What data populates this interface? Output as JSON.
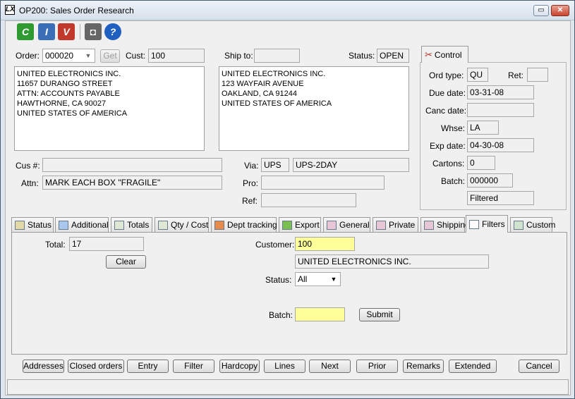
{
  "window": {
    "title": "OP200: Sales Order Research",
    "app_icon": "LX"
  },
  "toolbar": [
    {
      "name": "c-icon",
      "glyph": "C",
      "color": "#2f9a2f"
    },
    {
      "name": "i-icon",
      "glyph": "I",
      "color": "#3a6fb8"
    },
    {
      "name": "v-icon",
      "glyph": "V",
      "color": "#c0392b"
    },
    {
      "name": "camera-icon",
      "glyph": "◘",
      "color": "#666666"
    },
    {
      "name": "help-icon",
      "glyph": "?",
      "color": "#1f5fbf"
    }
  ],
  "header": {
    "order_label": "Order:",
    "order_value": "000020",
    "get_label": "Get",
    "cust_label": "Cust:",
    "cust_value": "100",
    "shipto_label": "Ship to:",
    "shipto_value": "",
    "status_label": "Status:",
    "status_value": "OPEN"
  },
  "billto_lines": [
    "UNITED ELECTRONICS INC.",
    "11657 DURANGO STREET",
    "ATTN: ACCOUNTS PAYABLE",
    "HAWTHORNE, CA 90027",
    "UNITED STATES OF AMERICA"
  ],
  "shipto_lines": [
    "UNITED ELECTRONICS INC.",
    "123 WAYFAIR AVENUE",
    "OAKLAND, CA 91244",
    "UNITED STATES OF AMERICA"
  ],
  "details": {
    "cus_label": "Cus #:",
    "cus_value": "",
    "attn_label": "Attn:",
    "attn_value": "MARK EACH BOX \"FRAGILE\"",
    "via_label": "Via:",
    "via_code": "UPS",
    "via_desc": "UPS-2DAY",
    "pro_label": "Pro:",
    "pro_value": "",
    "ref_label": "Ref:",
    "ref_value": ""
  },
  "control": {
    "tab_label": "Control",
    "ordtype_label": "Ord type:",
    "ordtype_value": "QU",
    "ret_label": "Ret:",
    "ret_value": "",
    "due_label": "Due date:",
    "due_value": "03-31-08",
    "canc_label": "Canc date:",
    "canc_value": "",
    "whse_label": "Whse:",
    "whse_value": "LA",
    "exp_label": "Exp date:",
    "exp_value": "04-30-08",
    "cartons_label": "Cartons:",
    "cartons_value": "0",
    "batch_label": "Batch:",
    "batch_value": "000000",
    "filtered_value": "Filtered"
  },
  "tabs": [
    {
      "label": "Status",
      "icon": "#e2d9a8"
    },
    {
      "label": "Additional",
      "icon": "#a9c6ec"
    },
    {
      "label": "Totals",
      "icon": "#dfe8d5"
    },
    {
      "label": "Qty / Cost",
      "icon": "#dfe8d5"
    },
    {
      "label": "Dept tracking",
      "icon": "#e88a4a"
    },
    {
      "label": "Export",
      "icon": "#7ac050"
    },
    {
      "label": "General",
      "icon": "#e7c7d6"
    },
    {
      "label": "Private",
      "icon": "#e7c7d6"
    },
    {
      "label": "Shipping",
      "icon": "#e7c7d6"
    },
    {
      "label": "Filters",
      "icon": "#ffffff"
    },
    {
      "label": "Custom",
      "icon": "#cfe3cf"
    }
  ],
  "filters": {
    "total_label": "Total:",
    "total_value": "17",
    "clear_label": "Clear",
    "customer_label": "Customer:",
    "customer_value": "100",
    "customer_name": "UNITED ELECTRONICS INC.",
    "status_label": "Status:",
    "status_value": "All",
    "batch_label": "Batch:",
    "batch_value": "",
    "submit_label": "Submit"
  },
  "bottom_buttons": [
    "Addresses",
    "Closed orders",
    "Entry",
    "Filter",
    "Hardcopy",
    "Lines",
    "Next",
    "Prior",
    "Remarks",
    "Extended",
    "Cancel"
  ],
  "statusbar": ""
}
